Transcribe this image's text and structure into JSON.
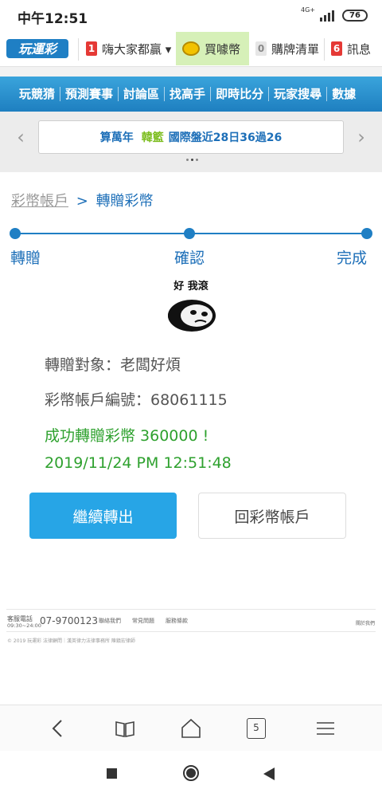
{
  "status_bar": {
    "time": "中午12:51",
    "battery": "76",
    "network": "4G+"
  },
  "top_nav": {
    "items": [
      {
        "num": "1",
        "label": "嗨大家都贏 ▾"
      },
      {
        "label": "買噱幣"
      },
      {
        "num": "0",
        "label": "購牌清單"
      },
      {
        "num": "6",
        "label": "訊息"
      }
    ]
  },
  "menu": [
    "玩競猜",
    "預測賽事",
    "討論區",
    "找高手",
    "即時比分",
    "玩家搜尋",
    "數據"
  ],
  "ticker": {
    "part1": "算萬年",
    "part2": "韓籃",
    "part3": "國際盤近28日36過26"
  },
  "breadcrumb": {
    "parent": "彩幣帳戶",
    "separator": ">",
    "current": "轉贈彩幣"
  },
  "steps": [
    "轉贈",
    "確認",
    "完成"
  ],
  "sticker": {
    "text": "好 我滾"
  },
  "info": {
    "recipient": "轉贈對象：老闆好煩",
    "account": "彩幣帳戶編號：68061115",
    "success": "成功轉贈彩幣 360000 !",
    "timestamp": "2019/11/24 PM 12:51:48"
  },
  "buttons": {
    "continue": "繼續轉出",
    "back": "回彩幣帳戶"
  },
  "footer": {
    "service_label": "客服電話",
    "service_hours": "09:30~24:00",
    "phone": "07-9700123",
    "links": [
      "聯絡我們",
      "常見問題",
      "服務條款"
    ],
    "right_link": "關於我們",
    "copyright": "© 2019 玩運彩 法律顧問｜漢英律力法律事務所 陳鎮宏律師"
  },
  "browser": {
    "tab_count": "5"
  },
  "colors": {
    "brand_blue": "#1f7fc4",
    "success_green": "#2ea12e",
    "primary_button": "#27a5e6"
  }
}
